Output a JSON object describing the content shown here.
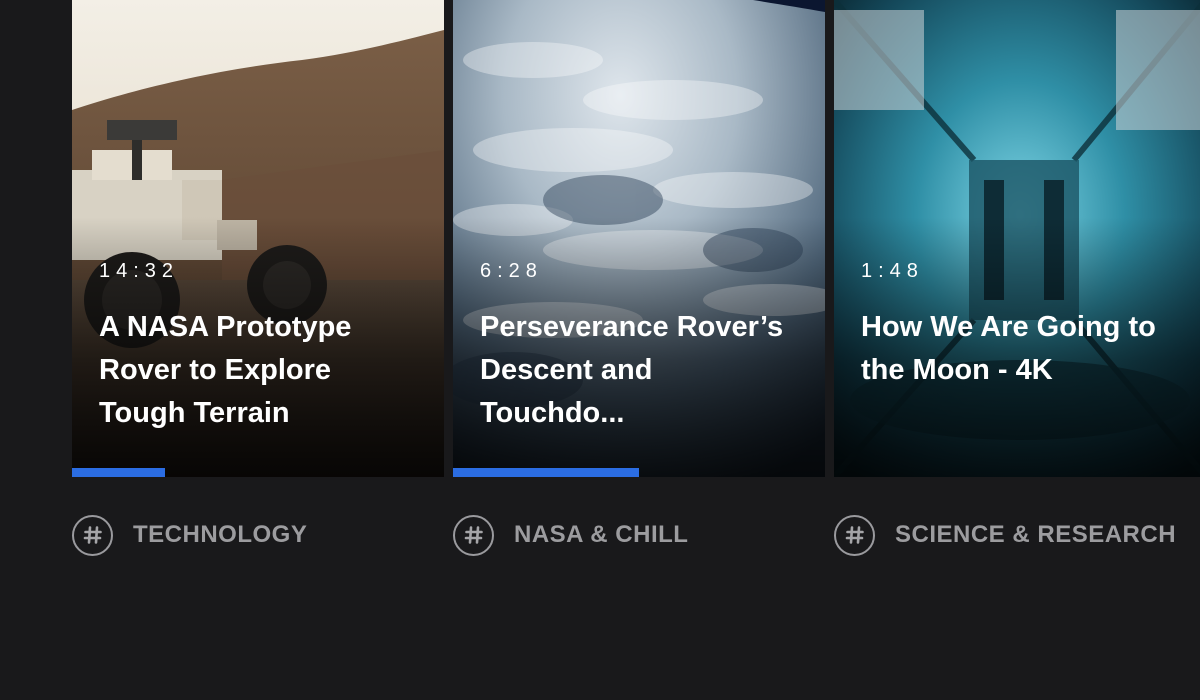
{
  "videos": [
    {
      "duration": "14:32",
      "title": "A NASA Prototype Rover to Explore Tough Terrain",
      "progress_fraction": 0.25,
      "category": "TECHNOLOGY",
      "thumbnail": "rover-on-rocky-hillside"
    },
    {
      "duration": "6:28",
      "title": "Perseverance Rover’s Descent and Touchdo...",
      "progress_fraction": 0.5,
      "category": "NASA & CHILL",
      "thumbnail": "earth-clouds-from-orbit"
    },
    {
      "duration": "1:48",
      "title": "How We Are Going to the Moon - 4K",
      "progress_fraction": 0,
      "category": "SCIENCE & RESEARCH",
      "thumbnail": "spacecraft-interior-teal"
    }
  ],
  "colors": {
    "background": "#19191b",
    "progress": "#2b6de3",
    "category_text": "#9c9c9f"
  },
  "icons": {
    "category": "hashtag-icon"
  }
}
